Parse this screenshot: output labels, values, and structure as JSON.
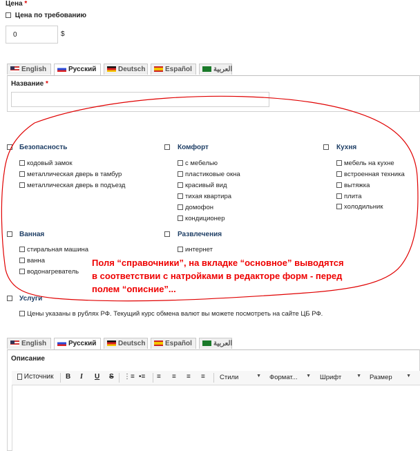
{
  "price": {
    "label": "Цена",
    "required_mark": "*",
    "on_request_label": "Цена по требованию",
    "value": "0",
    "currency": "$"
  },
  "tabs": [
    "English",
    "Русский",
    "Deutsch",
    "Español",
    "العربية"
  ],
  "name_field": {
    "label": "Название",
    "required_mark": "*",
    "value": ""
  },
  "groups": [
    {
      "title": "Безопасность",
      "options": [
        "кодовый замок",
        "металлическая дверь в тамбур",
        "металлическая дверь в подъезд"
      ]
    },
    {
      "title": "Комфорт",
      "options": [
        "с мебелью",
        "пластиковые окна",
        "красивый вид",
        "тихая квартира",
        "домофон",
        "кондиционер"
      ]
    },
    {
      "title": "Кухня",
      "options": [
        "мебель на кухне",
        "встроенная техника",
        "вытяжка",
        "плита",
        "холодильник"
      ]
    },
    {
      "title": "Ванная",
      "options": [
        "стиральная машина",
        "ванна",
        "водонагреватель"
      ]
    },
    {
      "title": "Развлечения",
      "options": [
        "интернет"
      ]
    },
    {
      "title": "Услуги",
      "options": []
    }
  ],
  "currency_note": "Цены указаны в рублях РФ. Текущий курс обмена валют вы можете посмотреть на сайте ЦБ РФ.",
  "annotation_lines": [
    "Поля “справочники”, на вкладке “основное” выводятся",
    "в соответствии с натройками в редакторе форм - перед",
    "полем “описние”..."
  ],
  "description": {
    "label": "Описание",
    "toolbar": {
      "source": "Источник",
      "bold": "B",
      "italic": "I",
      "underline": "U",
      "strike": "S",
      "styles": "Стили",
      "format": "Формат...",
      "font": "Шрифт",
      "size": "Размер"
    }
  },
  "colors": {
    "annotation": "#e00000",
    "group_title": "#1f3f66",
    "required": "#dd0000"
  }
}
